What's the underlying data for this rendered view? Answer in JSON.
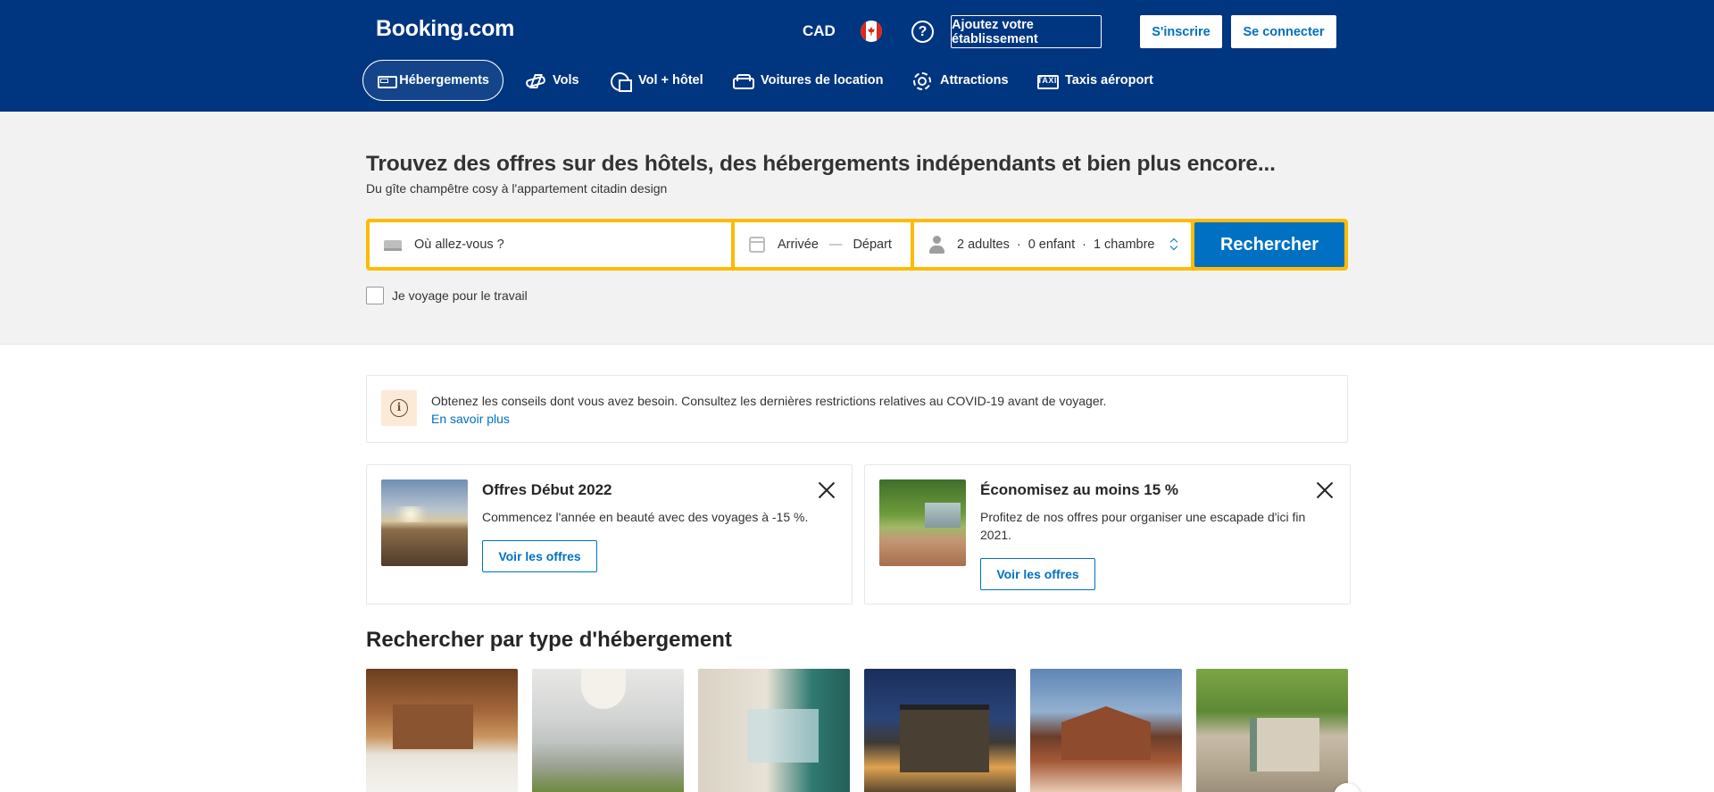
{
  "header": {
    "logo": "Booking.com",
    "currency": "CAD",
    "flag_icon": "canada-flag-icon",
    "help_symbol": "?",
    "list_property": "Ajoutez votre établissement",
    "register": "S'inscrire",
    "sign_in": "Se connecter",
    "background_color": "#003580"
  },
  "nav": {
    "items": [
      {
        "label": "Hébergements",
        "icon": "bed-icon",
        "active": true
      },
      {
        "label": "Vols",
        "icon": "plane-icon",
        "active": false
      },
      {
        "label": "Vol + hôtel",
        "icon": "plane-hotel-icon",
        "active": false
      },
      {
        "label": "Voitures de location",
        "icon": "car-icon",
        "active": false
      },
      {
        "label": "Attractions",
        "icon": "attractions-icon",
        "active": false
      },
      {
        "label": "Taxis aéroport",
        "icon": "taxi-icon",
        "active": false
      }
    ],
    "taxi_icon_text": "TAXI"
  },
  "hero": {
    "title": "Trouvez des offres sur des hôtels, des hébergements indépendants et bien plus encore...",
    "subtitle": "Du gîte champêtre cosy à l'appartement citadin design"
  },
  "search": {
    "destination_placeholder": "Où allez-vous ?",
    "checkin": "Arrivée",
    "separator": "—",
    "checkout": "Départ",
    "adults": "2 adultes",
    "children": "0 enfant",
    "rooms": "1 chambre",
    "dot": "·",
    "button": "Rechercher",
    "business_travel": "Je voyage pour le travail",
    "accent_color": "#febb02",
    "button_color": "#0071c2"
  },
  "notice": {
    "text": "Obtenez les conseils dont vous avez besoin. Consultez les dernières restrictions relatives au COVID-19 avant de voyager.",
    "link": "En savoir plus",
    "icon_symbol": "i"
  },
  "promos": [
    {
      "title": "Offres Début 2022",
      "text": "Commencez l'année en beauté avec des voyages à -15 %.",
      "button": "Voir les offres"
    },
    {
      "title": "Économisez au moins 15 %",
      "text": "Profitez de nos offres pour organiser une escapade d'ici fin 2021.",
      "button": "Voir les offres"
    }
  ],
  "accommodation": {
    "title": "Rechercher par type d'hébergement"
  }
}
